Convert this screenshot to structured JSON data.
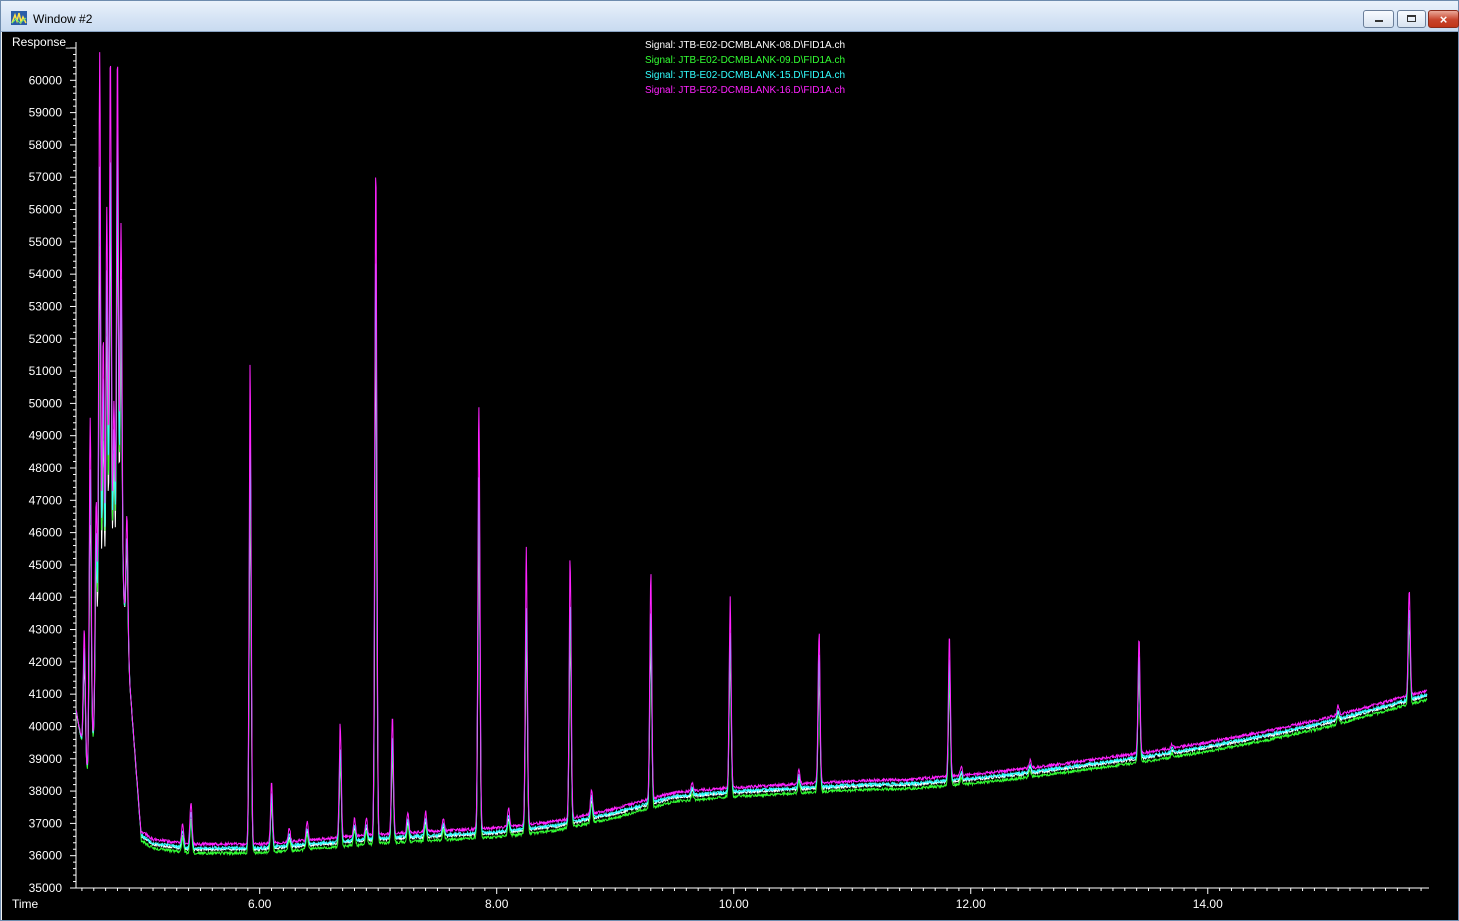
{
  "window": {
    "title": "Window #2",
    "close_glyph": "×",
    "icon": "chromatogram-app-icon"
  },
  "chart_data": {
    "type": "line",
    "ylabel": "Response_",
    "xlabel": "Time",
    "xlim": [
      4.45,
      15.85
    ],
    "ylim": [
      35000,
      61000
    ],
    "yticks": [
      35000,
      36000,
      37000,
      38000,
      39000,
      40000,
      41000,
      42000,
      43000,
      44000,
      45000,
      46000,
      47000,
      48000,
      49000,
      50000,
      51000,
      52000,
      53000,
      54000,
      55000,
      56000,
      57000,
      58000,
      59000,
      60000
    ],
    "xticks": [
      6.0,
      8.0,
      10.0,
      12.0,
      14.0
    ],
    "xtick_labels": [
      "6.00",
      "8.00",
      "10.00",
      "12.00",
      "14.00"
    ],
    "grid": false,
    "legend_position": "top-center",
    "series": [
      {
        "name": "Signal: JTB-E02-DCMBLANK-08.D\\FID1A.ch",
        "color": "#ffffff",
        "values": []
      },
      {
        "name": "Signal: JTB-E02-DCMBLANK-09.D\\FID1A.ch",
        "color": "#33ff33",
        "values": []
      },
      {
        "name": "Signal: JTB-E02-DCMBLANK-15.D\\FID1A.ch",
        "color": "#33ffff",
        "values": []
      },
      {
        "name": "Signal: JTB-E02-DCMBLANK-16.D\\FID1A.ch",
        "color": "#ff22ff",
        "values": []
      }
    ],
    "baseline": [
      [
        4.45,
        40500
      ],
      [
        4.55,
        38500
      ],
      [
        4.7,
        42000
      ],
      [
        4.85,
        44000
      ],
      [
        4.95,
        39000
      ],
      [
        5.0,
        36600
      ],
      [
        5.1,
        36350
      ],
      [
        5.4,
        36200
      ],
      [
        6.0,
        36200
      ],
      [
        6.5,
        36350
      ],
      [
        7.0,
        36500
      ],
      [
        7.5,
        36600
      ],
      [
        8.0,
        36700
      ],
      [
        8.5,
        36900
      ],
      [
        9.0,
        37300
      ],
      [
        9.5,
        37800
      ],
      [
        10.0,
        37950
      ],
      [
        10.5,
        38050
      ],
      [
        11.0,
        38150
      ],
      [
        11.5,
        38200
      ],
      [
        12.0,
        38350
      ],
      [
        12.5,
        38550
      ],
      [
        13.0,
        38800
      ],
      [
        13.5,
        39050
      ],
      [
        14.0,
        39350
      ],
      [
        14.5,
        39700
      ],
      [
        15.0,
        40100
      ],
      [
        15.5,
        40600
      ],
      [
        15.6,
        40700
      ],
      [
        15.85,
        40950
      ]
    ],
    "peaks": [
      {
        "x": 4.52,
        "y": 43000
      },
      {
        "x": 4.57,
        "y": 49500
      },
      {
        "x": 4.62,
        "y": 47000
      },
      {
        "x": 4.65,
        "y": 60800
      },
      {
        "x": 4.68,
        "y": 52000
      },
      {
        "x": 4.71,
        "y": 56000
      },
      {
        "x": 4.74,
        "y": 60800
      },
      {
        "x": 4.77,
        "y": 50000
      },
      {
        "x": 4.8,
        "y": 60800
      },
      {
        "x": 4.83,
        "y": 55500
      },
      {
        "x": 4.88,
        "y": 46500
      },
      {
        "x": 5.35,
        "y": 36800
      },
      {
        "x": 5.42,
        "y": 37500
      },
      {
        "x": 5.92,
        "y": 50900
      },
      {
        "x": 6.1,
        "y": 38100
      },
      {
        "x": 6.25,
        "y": 36700
      },
      {
        "x": 6.4,
        "y": 36900
      },
      {
        "x": 6.68,
        "y": 39900
      },
      {
        "x": 6.8,
        "y": 37000
      },
      {
        "x": 6.9,
        "y": 37000
      },
      {
        "x": 6.98,
        "y": 57800
      },
      {
        "x": 7.12,
        "y": 40100
      },
      {
        "x": 7.25,
        "y": 37200
      },
      {
        "x": 7.4,
        "y": 37200
      },
      {
        "x": 7.55,
        "y": 37000
      },
      {
        "x": 7.85,
        "y": 49900
      },
      {
        "x": 8.1,
        "y": 37300
      },
      {
        "x": 8.25,
        "y": 45100
      },
      {
        "x": 8.62,
        "y": 45000
      },
      {
        "x": 8.8,
        "y": 37900
      },
      {
        "x": 9.3,
        "y": 44500
      },
      {
        "x": 9.65,
        "y": 38100
      },
      {
        "x": 9.97,
        "y": 43700
      },
      {
        "x": 10.55,
        "y": 38500
      },
      {
        "x": 10.72,
        "y": 42800
      },
      {
        "x": 11.82,
        "y": 42600
      },
      {
        "x": 11.92,
        "y": 38600
      },
      {
        "x": 12.5,
        "y": 38800
      },
      {
        "x": 13.42,
        "y": 42600
      },
      {
        "x": 13.7,
        "y": 39300
      },
      {
        "x": 15.1,
        "y": 40500
      },
      {
        "x": 15.7,
        "y": 44200
      }
    ]
  }
}
